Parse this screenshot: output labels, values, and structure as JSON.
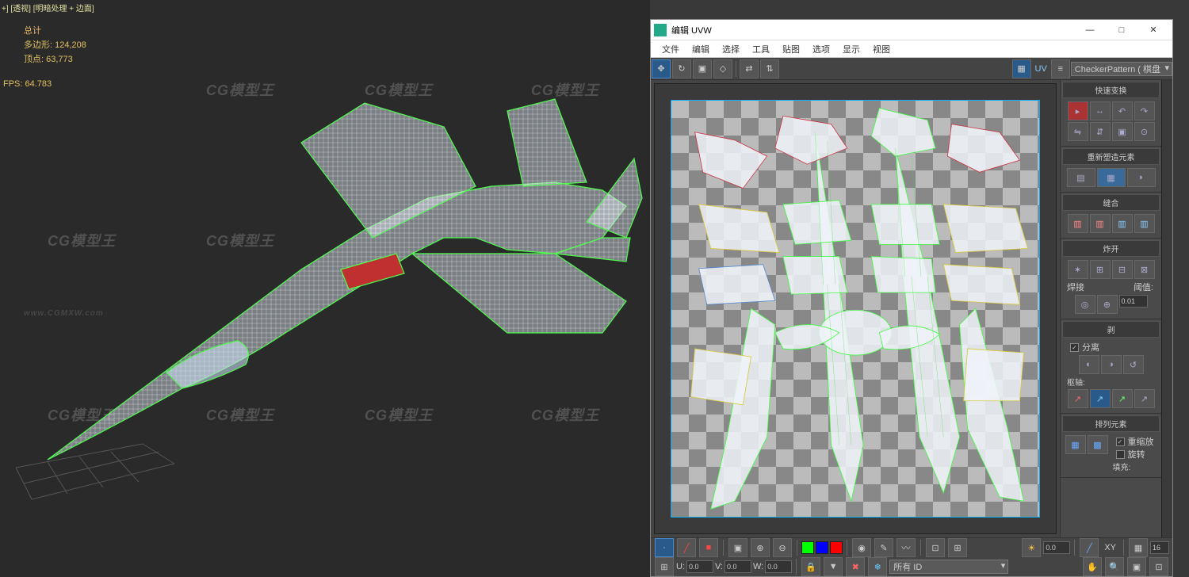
{
  "viewport": {
    "label": "+] [透视] [明暗处理 + 边面]",
    "stats_title": "总计",
    "polys_label": "多边形:",
    "polys_value": "124,208",
    "verts_label": "顶点:",
    "verts_value": "63,773",
    "fps_label": "FPS:",
    "fps_value": "64.783",
    "watermark": "CG模型王",
    "watermark_url": "www.CGMXW.com"
  },
  "uvw": {
    "title": "编辑 UVW",
    "menu": [
      "文件",
      "编辑",
      "选择",
      "工具",
      "贴图",
      "选项",
      "显示",
      "视图"
    ],
    "uv_label": "UV",
    "texture_dropdown": "CheckerPattern    ( 棋盘",
    "rollouts": {
      "quick_transform": "快速变换",
      "reshape": "重新塑造元素",
      "stitch": "缝合",
      "explode": "炸开",
      "weld_label": "焊接",
      "threshold_label": "阈值:",
      "threshold_value": "0.01",
      "peel": "剥",
      "separate": "分离",
      "axis": "枢轴:",
      "arrange": "排列元素",
      "rescale": "重缩放",
      "rotate": "旋转",
      "padding": "填充:"
    },
    "bottom": {
      "u_label": "U:",
      "u_value": "0.0",
      "v_label": "V:",
      "v_value": "0.0",
      "w_label": "W:",
      "w_value": "0.0",
      "num_zero": "0.0",
      "xy_label": "XY",
      "grid_val": "16",
      "filter_dropdown": "所有 ID"
    },
    "win_min": "—",
    "win_max": "□",
    "win_close": "✕"
  }
}
